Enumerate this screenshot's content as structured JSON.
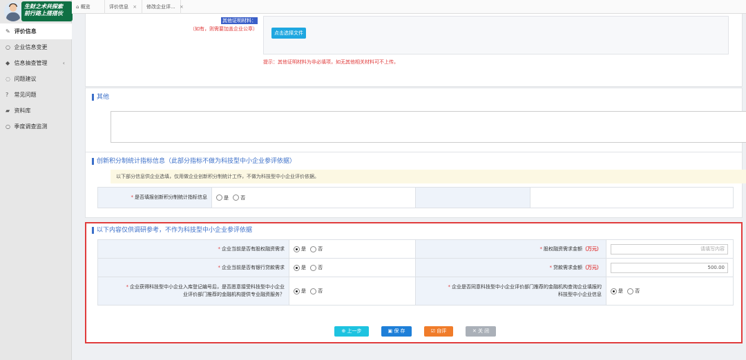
{
  "brand": {
    "slogan_line1": "生财之术共探索",
    "slogan_line2": "前行路上搭搭伙"
  },
  "sidebar": {
    "items": [
      {
        "label": "评价信息",
        "icon": "edit-icon",
        "glyph": "✎"
      },
      {
        "label": "企业信息变更",
        "icon": "circle-icon",
        "glyph": "○"
      },
      {
        "label": "信息抽查管理",
        "icon": "tag-icon",
        "glyph": "◆",
        "arrow": "‹"
      },
      {
        "label": "问题建议",
        "icon": "comment-icon",
        "glyph": "◌"
      },
      {
        "label": "常见问题",
        "icon": "question-icon",
        "glyph": "?"
      },
      {
        "label": "资料库",
        "icon": "folder-icon",
        "glyph": "▰"
      },
      {
        "label": "季度调查监测",
        "icon": "circle-icon",
        "glyph": "○"
      }
    ]
  },
  "tabs": [
    {
      "label": "概览",
      "icon": "home-icon",
      "glyph": "⌂"
    },
    {
      "label": "评价信息",
      "close": "×"
    },
    {
      "label": "修改企业评...",
      "close": "×"
    }
  ],
  "other_proof": {
    "label": "其他证明材料：",
    "hint": "（如有，则需要加盖企业公章）",
    "upload_button": "点击选择文件",
    "tip": "提示：其他证明材料为非必填项，如无其他相关材料可不上传。"
  },
  "other_section": {
    "title": "其他"
  },
  "innovation_section": {
    "title": "创新积分制统计指标信息（此部分指标不做为科技型中小企业参评依据）",
    "notice": "以下部分信息供企业选填，仅用做企业创新积分制统计工作，不做为科技型中小企业评价依据。",
    "question": "是否填报创新积分制统计指标信息",
    "yes": "是",
    "no": "否",
    "selected": "none"
  },
  "research_section": {
    "title": "以下内容仅供调研参考，不作为科技型中小企业参评依据",
    "rows": [
      {
        "left_label": "企业当前是否有股权融资需求",
        "left_selected": "yes",
        "right_label": "股权融资需求金额",
        "right_unit": "（万元）",
        "right_value": "",
        "right_placeholder": "请填写内容"
      },
      {
        "left_label": "企业当前是否有银行贷款需求",
        "left_selected": "yes",
        "right_label": "贷款需求金额",
        "right_unit": "（万元）",
        "right_value": "500.00"
      },
      {
        "left_label_1": "企业获得科技型中小企业入库登记编号后，是否愿意接受科技型中小企业",
        "left_label_2": "业评价部门推荐的金融机构提供专业融资服务？",
        "left_selected": "yes",
        "right_label_1": "企业是否同意科技型中小企业评价部门推荐的金融机构查询企业填报的",
        "right_label_2": "科技型中小企业信息",
        "right_selected": "yes"
      }
    ],
    "yes": "是",
    "no": "否"
  },
  "actions": {
    "prev": "上一步",
    "prev_glyph": "⊕",
    "save": "保 存",
    "save_glyph": "▣",
    "self_eval": "自评",
    "self_eval_glyph": "☑",
    "close": "关 闭",
    "close_glyph": "✕"
  },
  "colors": {
    "accent": "#3b6fc9",
    "required": "#e03b3b",
    "highlight_border": "#e03b3b",
    "brand_green": "#0f7044"
  }
}
